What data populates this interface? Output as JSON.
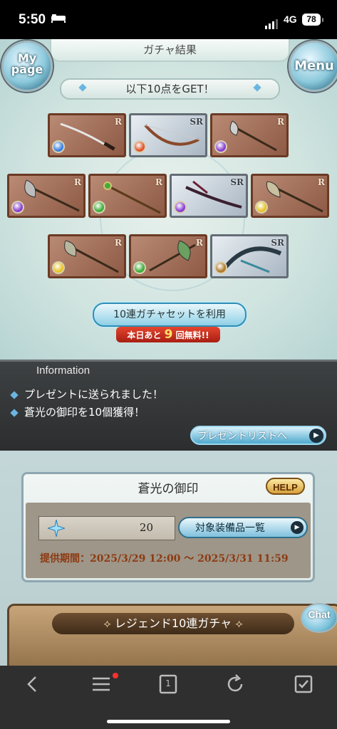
{
  "status_bar": {
    "time": "5:50",
    "network": "4G",
    "battery": "78"
  },
  "header": {
    "title": "ガチャ結果",
    "mypage_label": "My page",
    "menu_label": "Menu"
  },
  "result": {
    "banner": "以下10点をGET！",
    "items": [
      {
        "rarity": "R",
        "element": "water"
      },
      {
        "rarity": "SR",
        "element": "fire"
      },
      {
        "rarity": "R",
        "element": "dark"
      },
      {
        "rarity": "R",
        "element": "dark"
      },
      {
        "rarity": "R",
        "element": "wind"
      },
      {
        "rarity": "SR",
        "element": "dark"
      },
      {
        "rarity": "R",
        "element": "light"
      },
      {
        "rarity": "R",
        "element": "light"
      },
      {
        "rarity": "R",
        "element": "wind"
      },
      {
        "rarity": "SR",
        "element": "earth"
      }
    ],
    "gacha_button": "10連ガチャセットを利用",
    "free_prefix": "本日あと",
    "free_count": "9",
    "free_suffix": "回無料!!"
  },
  "information": {
    "title": "Information",
    "lines": [
      "プレゼントに送られました！",
      "蒼光の御印を10個獲得！"
    ],
    "present_button": "プレゼントリストへ"
  },
  "seal_panel": {
    "title": "蒼光の御印",
    "help_label": "HELP",
    "count": "20",
    "equip_button": "対象装備品一覧",
    "period": "提供期間：2025/3/29 12:00 〜 2025/3/31 11:59"
  },
  "legend_banner": {
    "title": "レジェンド10連ガチャ",
    "chat_label": "Chat"
  },
  "colors": {
    "water": "#3a7fe0",
    "fire": "#e0542a",
    "dark": "#8a3fd0",
    "wind": "#3fae3a",
    "light": "#e8c42a",
    "earth": "#b07a2a"
  },
  "browser_toolbar": {
    "tabs_count": "1"
  }
}
